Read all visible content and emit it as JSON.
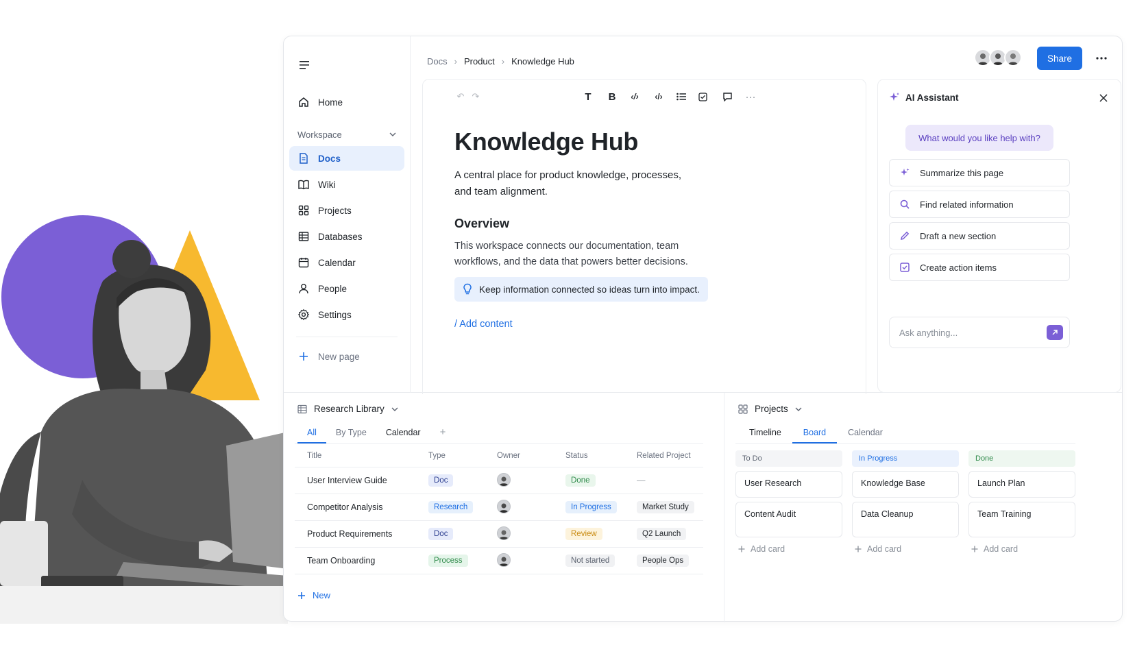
{
  "colors": {
    "accent": "#1f6fe3",
    "ai_purple": "#7b5fd6",
    "hero_circle": "#7b5fd6",
    "hero_triangle": "#f7b92f"
  },
  "sidebar": {
    "home": "Home",
    "workspace_label": "Workspace",
    "items": [
      {
        "label": "Docs",
        "icon": "doc-icon",
        "active": true
      },
      {
        "label": "Wiki",
        "icon": "book-icon"
      },
      {
        "label": "Projects",
        "icon": "grid-icon"
      },
      {
        "label": "Databases",
        "icon": "table-icon"
      },
      {
        "label": "Calendar",
        "icon": "calendar-icon"
      },
      {
        "label": "People",
        "icon": "person-icon"
      },
      {
        "label": "Settings",
        "icon": "gear-icon"
      }
    ],
    "new_page": "New page"
  },
  "breadcrumb": [
    "Docs",
    "Product",
    "Knowledge Hub"
  ],
  "header": {
    "share_label": "Share"
  },
  "editor": {
    "title": "Knowledge Hub",
    "subtitle": "A central place for product knowledge, processes, and team alignment.",
    "overview_heading": "Overview",
    "overview_text": "This workspace connects our documentation, team workflows, and the data that powers better decisions.",
    "callout": "Keep information connected so ideas turn into impact.",
    "add_content": "/ Add content"
  },
  "ai": {
    "title": "AI Assistant",
    "prompt": "What would you like help with?",
    "actions": [
      {
        "label": "Summarize this page",
        "icon": "sparkle-icon"
      },
      {
        "label": "Find related information",
        "icon": "search-icon"
      },
      {
        "label": "Draft a new section",
        "icon": "pencil-icon"
      },
      {
        "label": "Create action items",
        "icon": "checkbox-icon"
      }
    ],
    "input_placeholder": "Ask anything..."
  },
  "library": {
    "title": "Research Library",
    "tabs": [
      "All",
      "By Type",
      "Calendar"
    ],
    "columns": [
      "Title",
      "Type",
      "Owner",
      "Status",
      "Related Project"
    ],
    "rows": [
      {
        "title": "User Interview Guide",
        "type": "Doc",
        "status": "Done",
        "project": "—"
      },
      {
        "title": "Competitor Analysis",
        "type": "Research",
        "status": "In Progress",
        "project": "Market Study"
      },
      {
        "title": "Product Requirements",
        "type": "Doc",
        "status": "Review",
        "project": "Q2 Launch"
      },
      {
        "title": "Team Onboarding",
        "type": "Process",
        "status": "Not started",
        "project": "People Ops"
      }
    ],
    "new_label": "New"
  },
  "projects": {
    "title": "Projects",
    "tabs": [
      "Timeline",
      "Board",
      "Calendar"
    ],
    "columns": [
      {
        "name": "To Do",
        "cards": [
          "User Research",
          "Content Audit"
        ]
      },
      {
        "name": "In Progress",
        "cards": [
          "Knowledge Base",
          "Data Cleanup"
        ]
      },
      {
        "name": "Done",
        "cards": [
          "Launch Plan",
          "Team Training"
        ]
      }
    ],
    "add_card": "Add card"
  }
}
